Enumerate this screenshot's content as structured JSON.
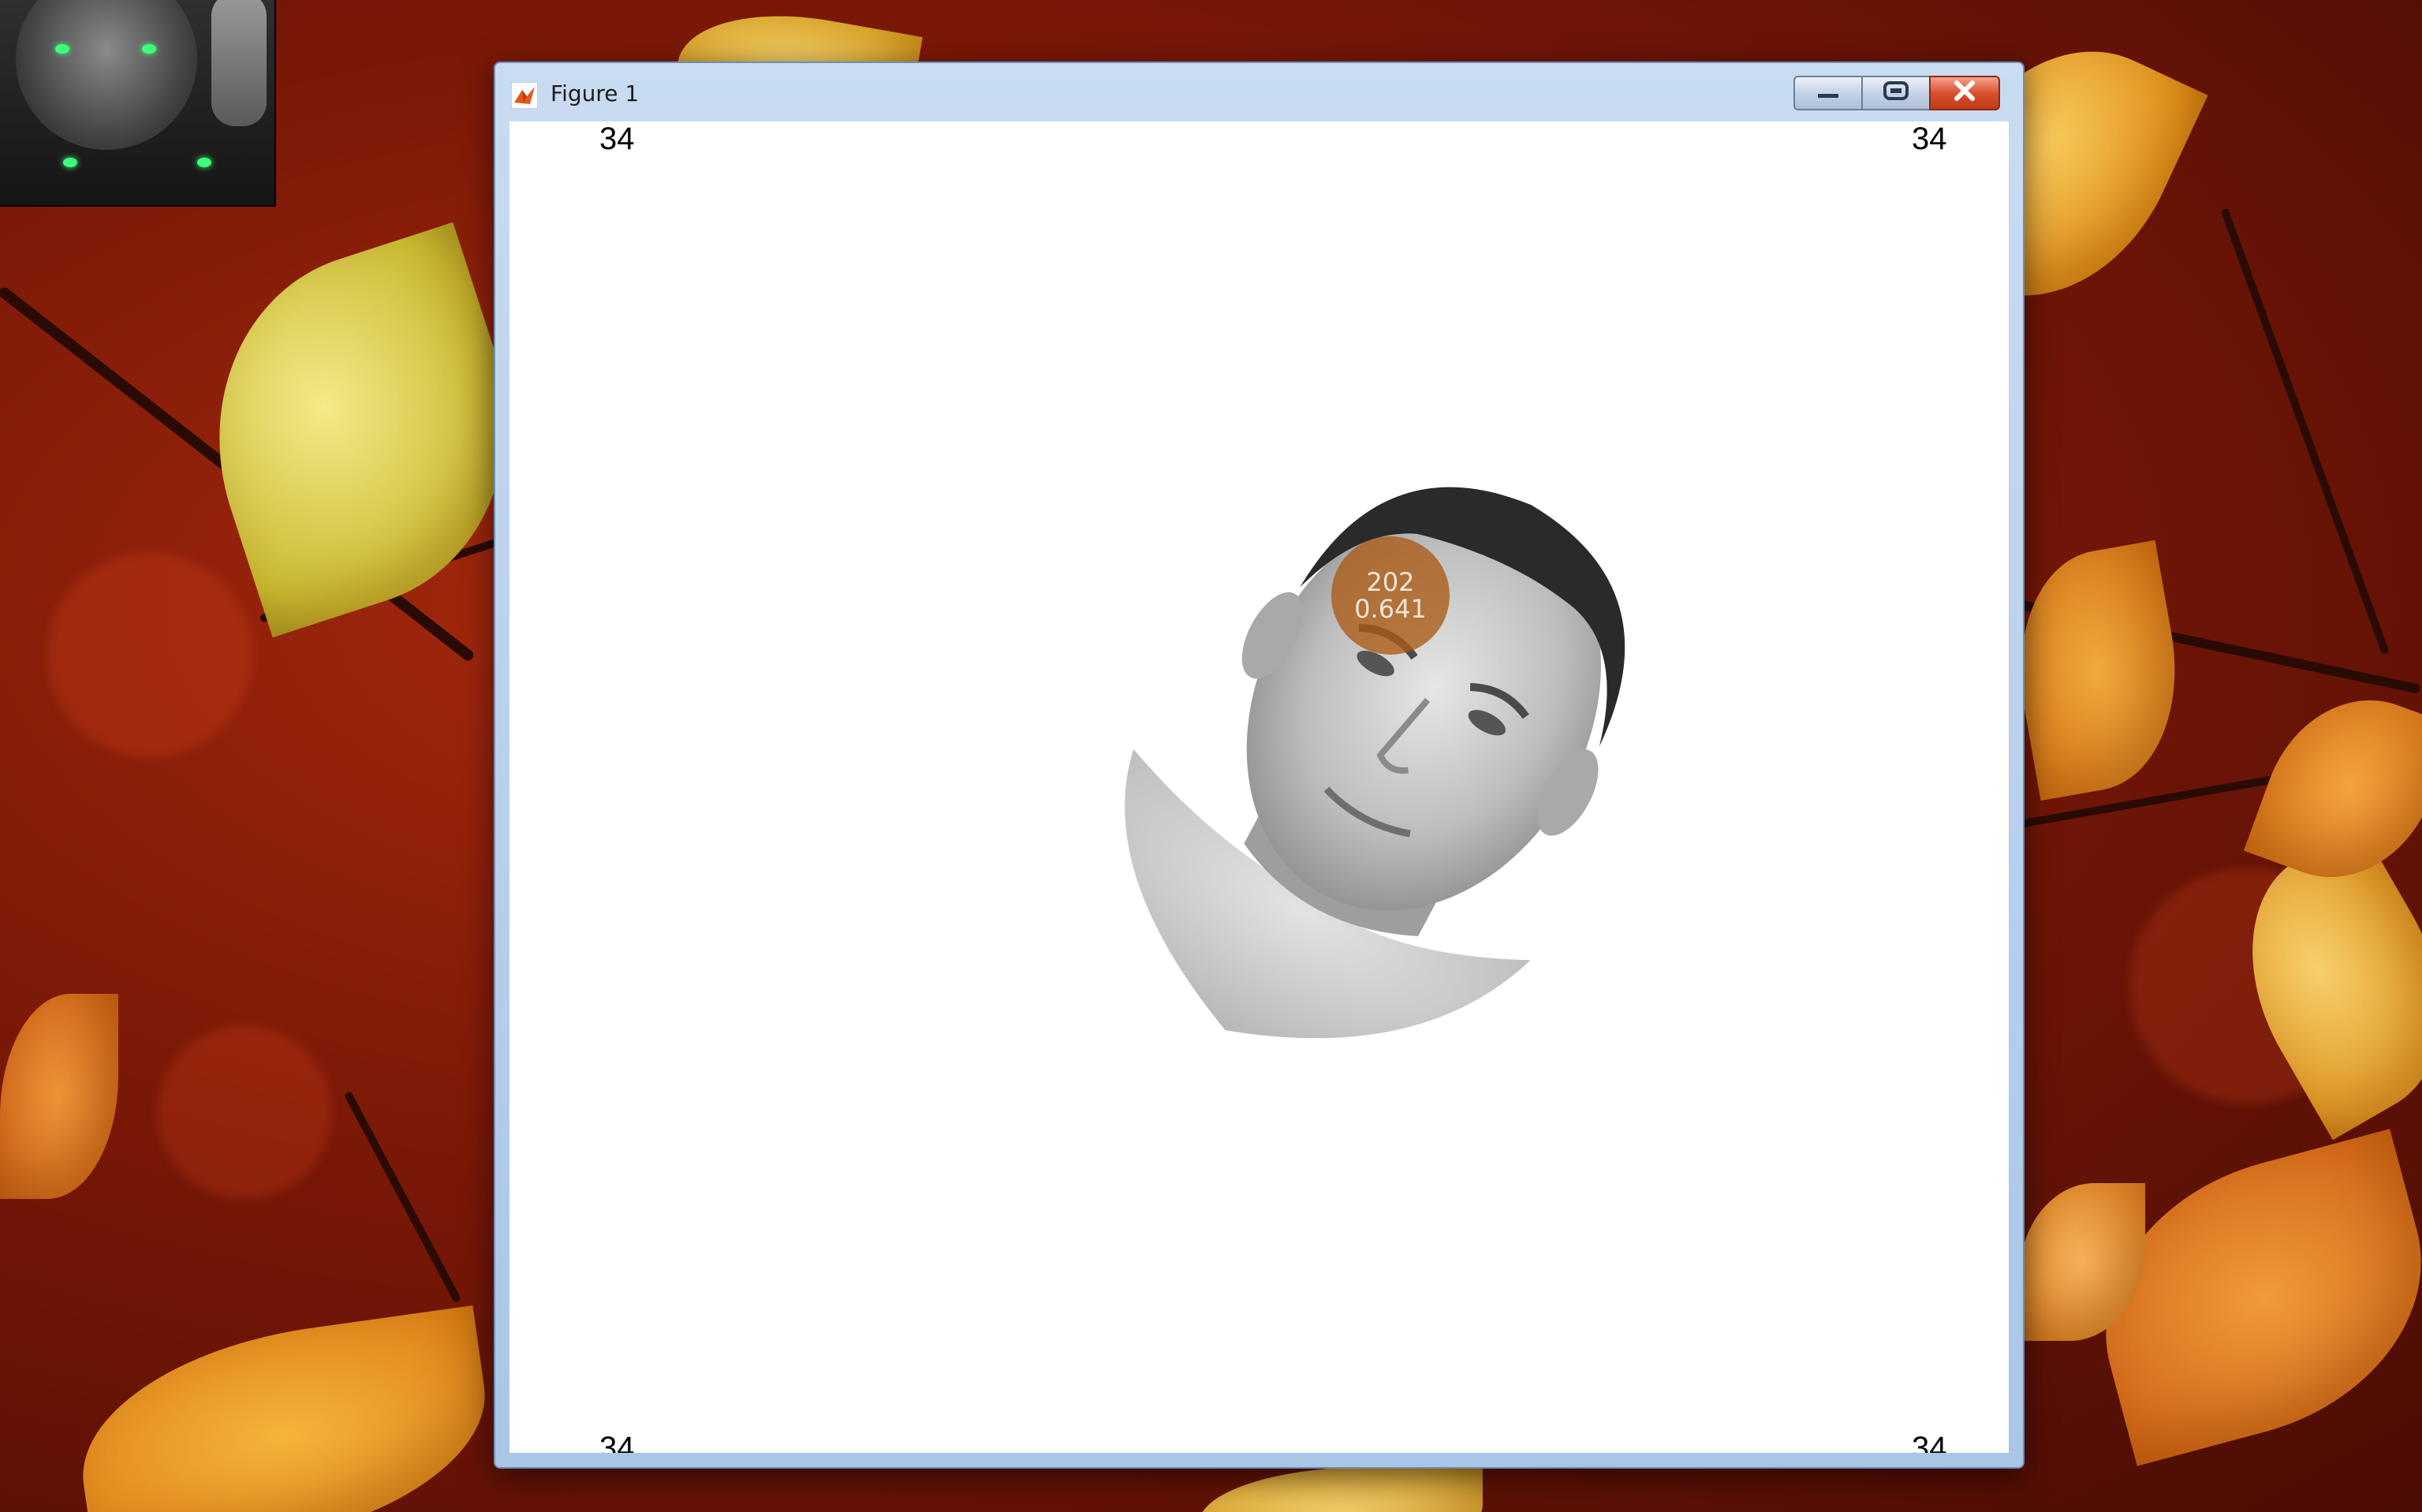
{
  "window": {
    "title": "Figure 1",
    "icon": "matlab-icon"
  },
  "titlebar_buttons": {
    "minimize": "minimize-icon",
    "maximize": "maximize-icon",
    "close": "close-icon"
  },
  "figure": {
    "corner_labels": {
      "top_left": "34",
      "top_right": "34",
      "bottom_left": "34",
      "bottom_right": "34"
    },
    "gaze_marker": {
      "value": "202",
      "score": "0.641",
      "color": "#aa5a14"
    }
  },
  "desktop": {
    "wallpaper": "autumn-leaves",
    "accent": "#a82a0e"
  }
}
